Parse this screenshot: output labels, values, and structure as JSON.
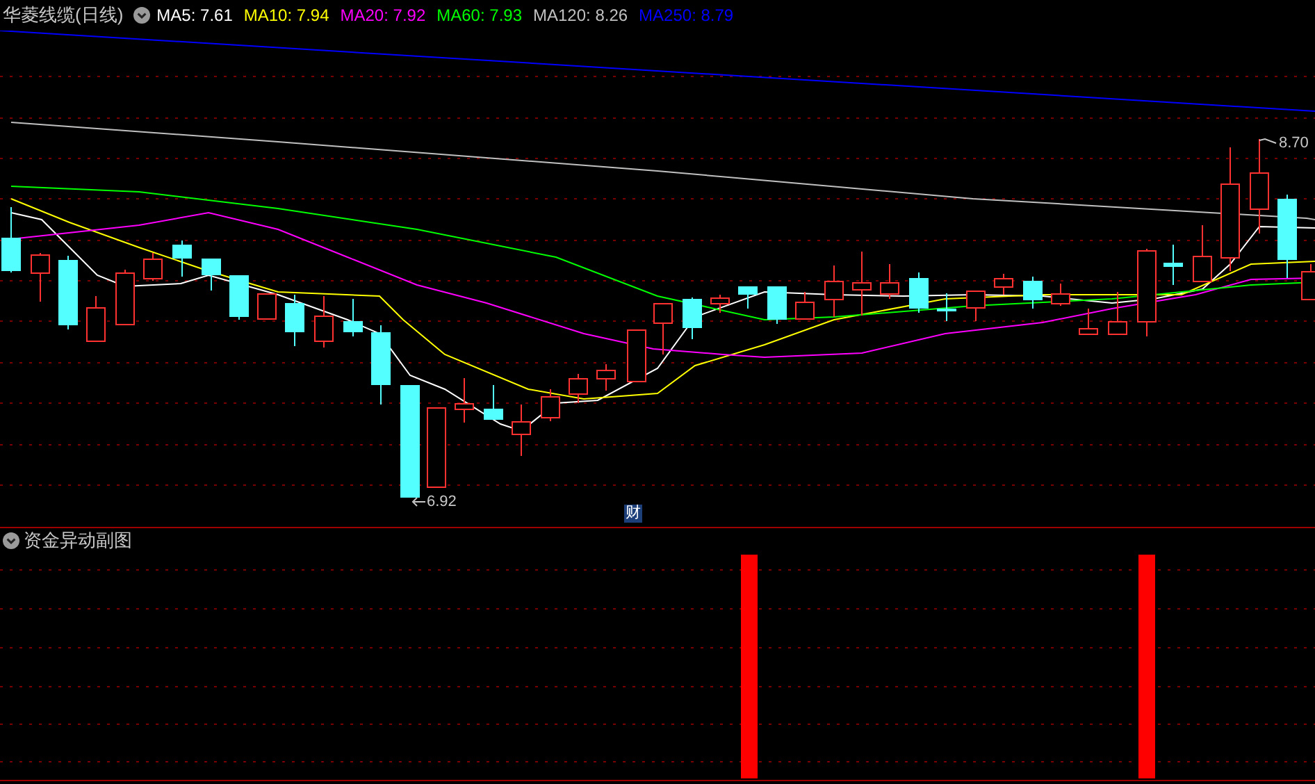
{
  "header": {
    "title": "华菱线缆(日线)",
    "indicators": [
      {
        "label": "MA5: 7.61",
        "color": "#ffffff"
      },
      {
        "label": "MA10: 7.94",
        "color": "#ffff00"
      },
      {
        "label": "MA20: 7.92",
        "color": "#ff00ff"
      },
      {
        "label": "MA60: 7.93",
        "color": "#00ff00"
      },
      {
        "label": "MA120: 8.26",
        "color": "#c0c0c0"
      },
      {
        "label": "MA250: 8.79",
        "color": "#0000ff"
      }
    ]
  },
  "main_chart": {
    "high_label": "8.70",
    "low_label": "6.92",
    "badge": "财"
  },
  "sub_panel": {
    "title": "资金异动副图"
  }
}
